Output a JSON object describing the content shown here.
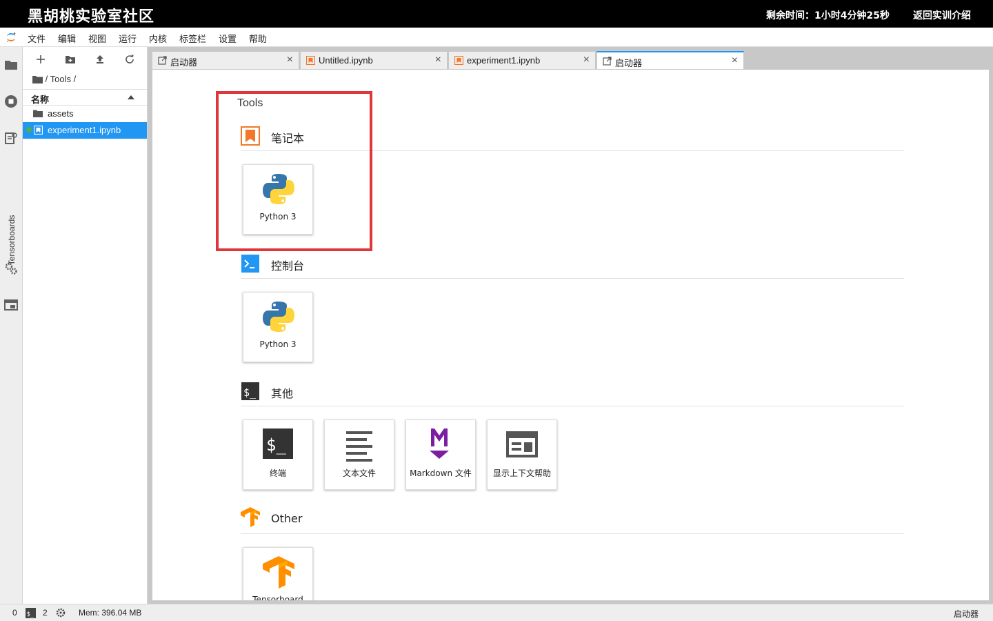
{
  "topbar": {
    "brand": "黑胡桃实验室社区",
    "timer": "剩余时间：1小时4分钟25秒",
    "back_link": "返回实训介绍"
  },
  "menu": {
    "items": [
      "文件",
      "编辑",
      "视图",
      "运行",
      "内核",
      "标签栏",
      "设置",
      "帮助"
    ]
  },
  "rail": {
    "tensorboards_label": "Tensorboards"
  },
  "file_browser": {
    "breadcrumb": "/ Tools /",
    "column_header": "名称",
    "rows": [
      {
        "name": "assets",
        "type": "folder"
      },
      {
        "name": "experiment1.ipynb",
        "type": "notebook",
        "selected": true
      }
    ]
  },
  "tabs": [
    {
      "label": "启动器",
      "icon": "launcher-icon"
    },
    {
      "label": "Untitled.ipynb",
      "icon": "notebook-icon"
    },
    {
      "label": "experiment1.ipynb",
      "icon": "notebook-icon"
    },
    {
      "label": "启动器",
      "icon": "launcher-icon",
      "active": true
    }
  ],
  "launcher": {
    "title": "Tools",
    "sections": [
      {
        "title": "笔记本",
        "icon": "notebook-section-icon",
        "cards": [
          "Python 3"
        ]
      },
      {
        "title": "控制台",
        "icon": "console-section-icon",
        "cards": [
          "Python 3"
        ]
      },
      {
        "title": "其他",
        "icon": "other-section-icon",
        "cards": [
          "终端",
          "文本文件",
          "Markdown 文件",
          "显示上下文帮助"
        ]
      },
      {
        "title": "Other",
        "icon": "tensorflow-section-icon",
        "cards": [
          "Tensorboard"
        ]
      }
    ]
  },
  "statusbar": {
    "kernels": "0",
    "terminals": "2",
    "memory": "Mem: 396.04 MB",
    "right_label": "启动器"
  },
  "colors": {
    "accent": "#2196f3",
    "highlight_box": "#e0353b",
    "notebook_orange": "#f37726",
    "markdown_purple": "#7b1fa2",
    "running_dot": "#4caf50"
  }
}
